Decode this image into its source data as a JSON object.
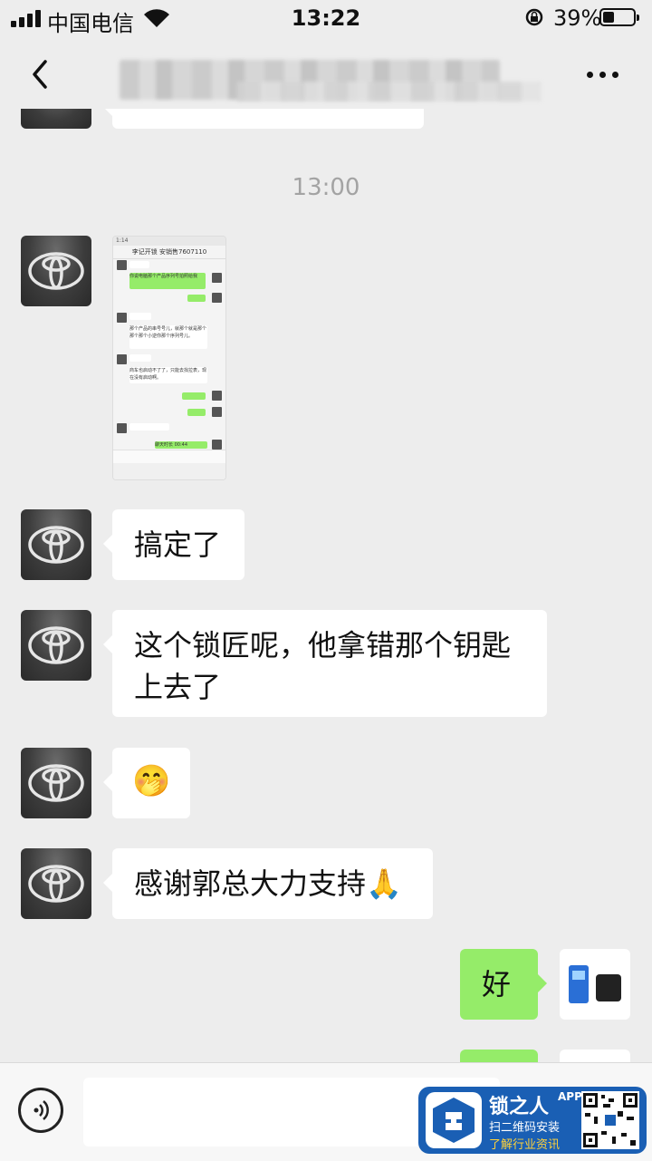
{
  "status": {
    "carrier": "中国电信",
    "time": "13:22",
    "battery": "39%",
    "battery_level": 0.39
  },
  "nav": {
    "back_icon": "chevron-left-icon",
    "more_icon": "more-dots-icon"
  },
  "messages": {
    "timestamp": "13:00",
    "shot": {
      "title": "李记开锁 安销售7607110",
      "rows": [
        "你说电脑那个产品序列号拍照给我",
        "有了",
        "那个产品的串号号儿，就那个就是那个那个那个小逆你那个序列号儿。",
        "商车也启动不了了，只能去找拉表，现在没有启动啊。",
        "有了号",
        "精蓉",
        "聊天时长 00:44"
      ]
    },
    "m1": "搞定了",
    "m2": "这个锁匠呢，他拿错那个钥匙上去了",
    "m3_emoji": "🤭",
    "m4": "感谢郭总大力支持🙏",
    "m5": "好"
  },
  "watermark": {
    "name": "锁之人",
    "app": "APP",
    "line1": "扫二维码安装",
    "line2": "了解行业资讯"
  }
}
